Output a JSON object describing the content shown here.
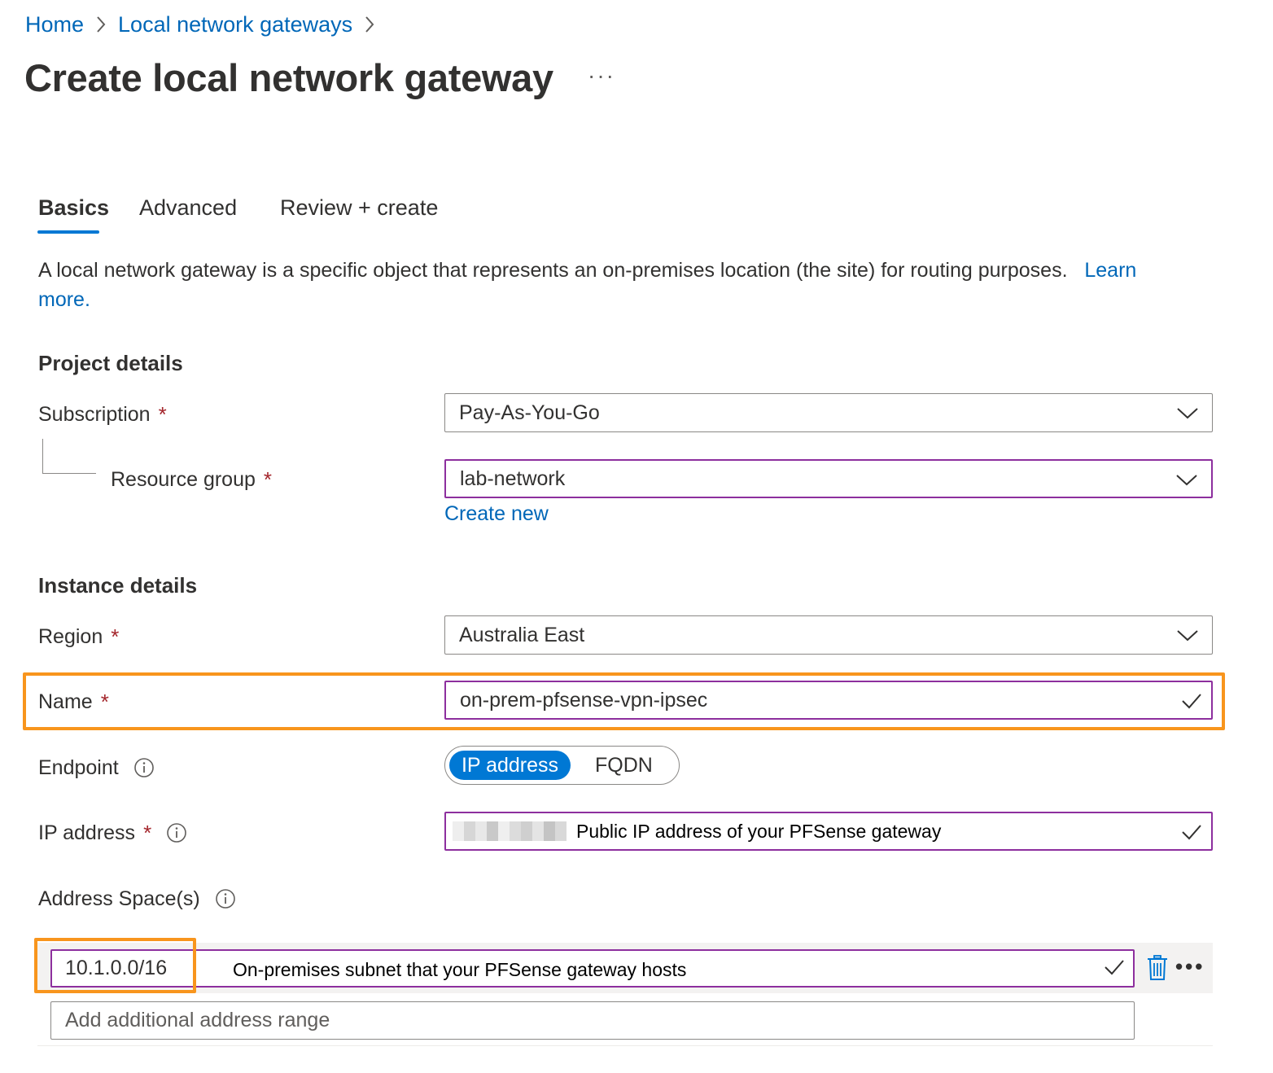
{
  "breadcrumb": {
    "home": "Home",
    "parent": "Local network gateways"
  },
  "page": {
    "title": "Create local network gateway",
    "more": "···"
  },
  "tabs": [
    {
      "label": "Basics",
      "active": true
    },
    {
      "label": "Advanced",
      "active": false
    },
    {
      "label": "Review + create",
      "active": false
    }
  ],
  "description": {
    "text": "A local network gateway is a specific object that represents an on-premises location (the site) for routing purposes.",
    "link": "Learn more."
  },
  "project": {
    "heading": "Project details",
    "subscription_label": "Subscription",
    "subscription_value": "Pay-As-You-Go",
    "resource_group_label": "Resource group",
    "resource_group_value": "lab-network",
    "create_new": "Create new"
  },
  "instance": {
    "heading": "Instance details",
    "region_label": "Region",
    "region_value": "Australia East",
    "name_label": "Name",
    "name_value": "on-prem-pfsense-vpn-ipsec",
    "endpoint_label": "Endpoint",
    "endpoint_options": [
      "IP address",
      "FQDN"
    ],
    "endpoint_selected": "IP address",
    "ip_label": "IP address",
    "ip_helper": "Public IP address of your PFSense gateway",
    "address_space_label": "Address Space(s)",
    "address_value": "10.1.0.0/16",
    "address_helper": "On-premises subnet that your PFSense gateway hosts",
    "address_add_placeholder": "Add additional address range"
  },
  "required_marker": "*",
  "colors": {
    "link": "#0067b8",
    "accent": "#0078d4",
    "required": "#a4262c",
    "focus_border": "#8d2f9e",
    "highlight": "#f8951d"
  },
  "icons": {
    "chevron": "chevron-right-icon",
    "dropdown": "chevron-down-icon",
    "check": "checkmark-icon",
    "info": "info-icon",
    "trash": "trash-icon"
  }
}
